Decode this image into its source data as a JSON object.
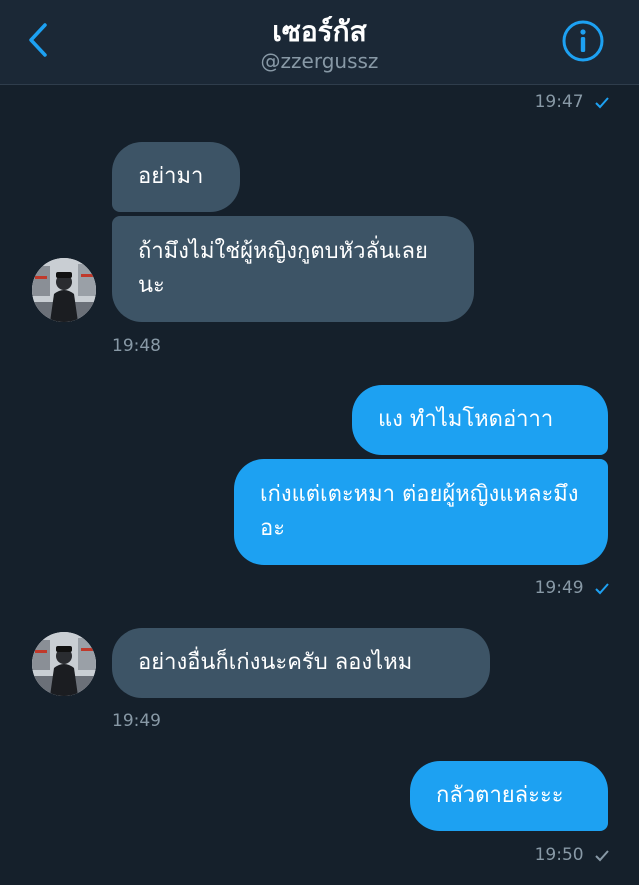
{
  "header": {
    "title": "เซอร์กัส",
    "handle": "@zzergussz"
  },
  "messages": [
    {
      "id": "t0",
      "text": "19:47"
    },
    {
      "id": "m1",
      "text": "อย่ามา"
    },
    {
      "id": "m2",
      "text": "ถ้ามึงไม่ใช่ผู้หญิงกูตบหัวลั่นเลยนะ"
    },
    {
      "id": "t1",
      "text": "19:48"
    },
    {
      "id": "m3",
      "text": "แง ทำไมโหดอ่าาา"
    },
    {
      "id": "m4",
      "text": "เก่งแต่เตะหมา ต่อยผู้หญิงแหละมึงอะ"
    },
    {
      "id": "t2",
      "text": "19:49"
    },
    {
      "id": "m5",
      "text": "อย่างอื่นก็เก่งนะครับ ลองไหม"
    },
    {
      "id": "t3",
      "text": "19:49"
    },
    {
      "id": "m6",
      "text": "กลัวตายล่ะะะ"
    },
    {
      "id": "t4",
      "text": "19:50"
    }
  ],
  "colors": {
    "background": "#15202b",
    "header": "#1b2836",
    "incoming_bubble": "#3d5466",
    "outgoing_bubble": "#1da1f2",
    "accent": "#1da1f2",
    "muted": "#8899a6"
  },
  "icons": [
    "back-chevron-icon",
    "info-icon",
    "sent-check-icon",
    "read-check-icon"
  ]
}
